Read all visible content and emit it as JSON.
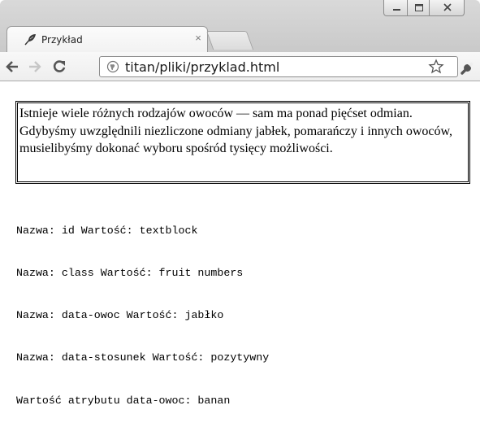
{
  "tab": {
    "title": "Przykład",
    "close_glyph": "×",
    "favicon": "feather-icon"
  },
  "window_controls": {
    "minimize": "minimize-icon",
    "maximize": "maximize-icon",
    "close": "close-icon"
  },
  "toolbar": {
    "back": "back-arrow-icon",
    "forward": "forward-arrow-icon",
    "reload": "reload-icon",
    "url": "titan/pliki/przyklad.html",
    "bookmark": "star-icon",
    "menu": "wrench-icon"
  },
  "content": {
    "paragraph": "Istnieje wiele różnych rodzajów owoców — sam ma ponad pięćset odmian. Gdybyśmy uwzględnili niezliczone odmiany jabłek, pomarańczy i innych owoców, musielibyśmy dokonać wyboru spośród tysięcy możliwości.",
    "output_lines": [
      "Nazwa: id Wartość: textblock",
      "Nazwa: class Wartość: fruit numbers",
      "Nazwa: data-owoc Wartość: jabłko",
      "Nazwa: data-stosunek Wartość: pozytywny",
      "Wartość atrybutu data-owoc: banan"
    ]
  }
}
